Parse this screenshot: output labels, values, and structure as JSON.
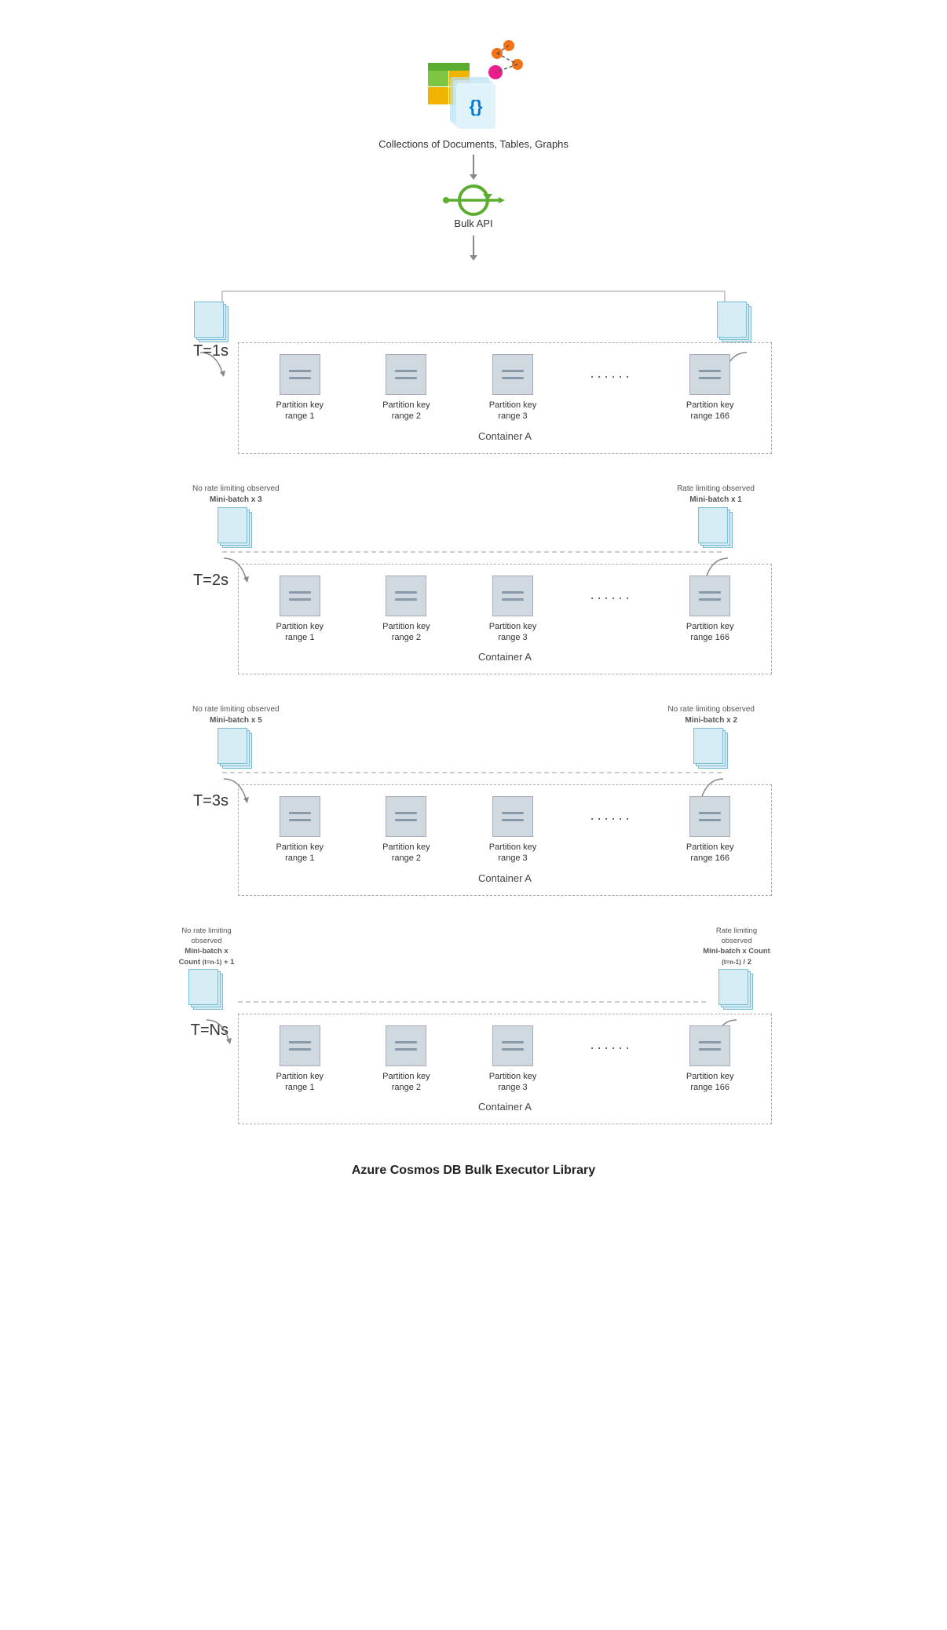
{
  "header": {
    "collections_label": "Collections of Documents, Tables, Graphs",
    "bulk_api_label": "Bulk API"
  },
  "footer": {
    "title": "Azure Cosmos DB Bulk Executor Library"
  },
  "container_label": "Container A",
  "partitions": [
    {
      "label": "Partition key\nrange 1"
    },
    {
      "label": "Partition key\nrange 2"
    },
    {
      "label": "Partition key\nrange 3"
    },
    {
      "label": "Partition key\nrange 166"
    }
  ],
  "time_sections": [
    {
      "id": "t1",
      "time_label": "T=1s",
      "left_batch": {
        "show_info": false,
        "info_line1": "",
        "info_line2": ""
      },
      "right_batch": {
        "show_info": false,
        "info_line1": "",
        "info_line2": ""
      }
    },
    {
      "id": "t2",
      "time_label": "T=2s",
      "left_batch": {
        "show_info": true,
        "info_line1": "No rate limiting observed",
        "info_line2": "Mini-batch x 3"
      },
      "right_batch": {
        "show_info": true,
        "info_line1": "Rate limiting observed",
        "info_line2": "Mini-batch x 1"
      }
    },
    {
      "id": "t3",
      "time_label": "T=3s",
      "left_batch": {
        "show_info": true,
        "info_line1": "No rate limiting observed",
        "info_line2": "Mini-batch x 5"
      },
      "right_batch": {
        "show_info": true,
        "info_line1": "No rate limiting observed",
        "info_line2": "Mini-batch x 2"
      }
    },
    {
      "id": "tN",
      "time_label": "T=Ns",
      "left_batch": {
        "show_info": true,
        "info_line1": "No rate limiting observed",
        "info_line2": "Mini-batch x Count (t=n-1) + 1"
      },
      "right_batch": {
        "show_info": true,
        "info_line1": "Rate limiting observed",
        "info_line2": "Mini-batch x Count (t=n-1) / 2"
      }
    }
  ]
}
